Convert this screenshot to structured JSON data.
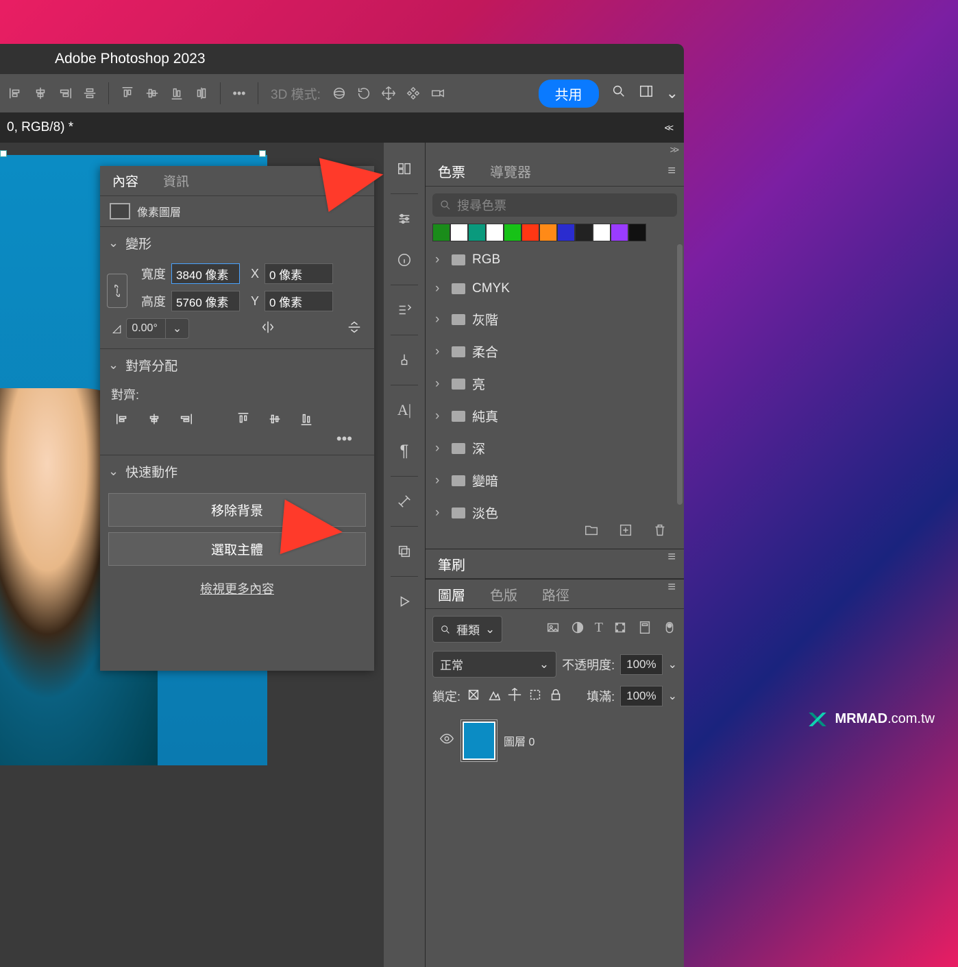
{
  "app_title": "Adobe Photoshop 2023",
  "options_bar": {
    "mode_label": "3D 模式:",
    "share_label": "共用"
  },
  "tab_strip": {
    "doc_label": "0, RGB/8) *"
  },
  "properties_panel": {
    "tabs": {
      "content": "內容",
      "info": "資訊"
    },
    "layer_type": "像素圖層",
    "sections": {
      "transform": "變形",
      "align": "對齊分配",
      "quick_actions": "快速動作"
    },
    "transform": {
      "w_label": "寬度",
      "w_value": "3840 像素",
      "h_label": "高度",
      "h_value": "5760 像素",
      "x_label": "X",
      "x_value": "0 像素",
      "y_label": "Y",
      "y_value": "0 像素",
      "rotation": "0.00°"
    },
    "align_label": "對齊:",
    "quick": {
      "remove_bg": "移除背景",
      "select_subject": "選取主體",
      "view_more": "檢視更多內容"
    }
  },
  "swatch_panel": {
    "tabs": {
      "swatches": "色票",
      "navigator": "導覽器"
    },
    "search_placeholder": "搜尋色票",
    "swatches": [
      "#1a8c1a",
      "#ffffff",
      "#0a9a7d",
      "#ffffff",
      "#17c217",
      "#ff3714",
      "#ff8a17",
      "#2a2ccf",
      "#222222",
      "#ffffff",
      "#9a3cff",
      "#111111"
    ],
    "folders": [
      "RGB",
      "CMYK",
      "灰階",
      "柔合",
      "亮",
      "純真",
      "深",
      "變暗",
      "淡色"
    ]
  },
  "brush_panel": {
    "tab": "筆刷"
  },
  "layers_panel": {
    "tabs": {
      "layers": "圖層",
      "channels": "色版",
      "paths": "路徑"
    },
    "filter_label": "種類",
    "blend_mode": "正常",
    "opacity_label": "不透明度:",
    "opacity_value": "100%",
    "lock_label": "鎖定:",
    "fill_label": "填滿:",
    "fill_value": "100%",
    "layer_name": "圖層 0"
  },
  "watermark": {
    "brand": "MRMAD",
    "domain": ".com.tw"
  }
}
